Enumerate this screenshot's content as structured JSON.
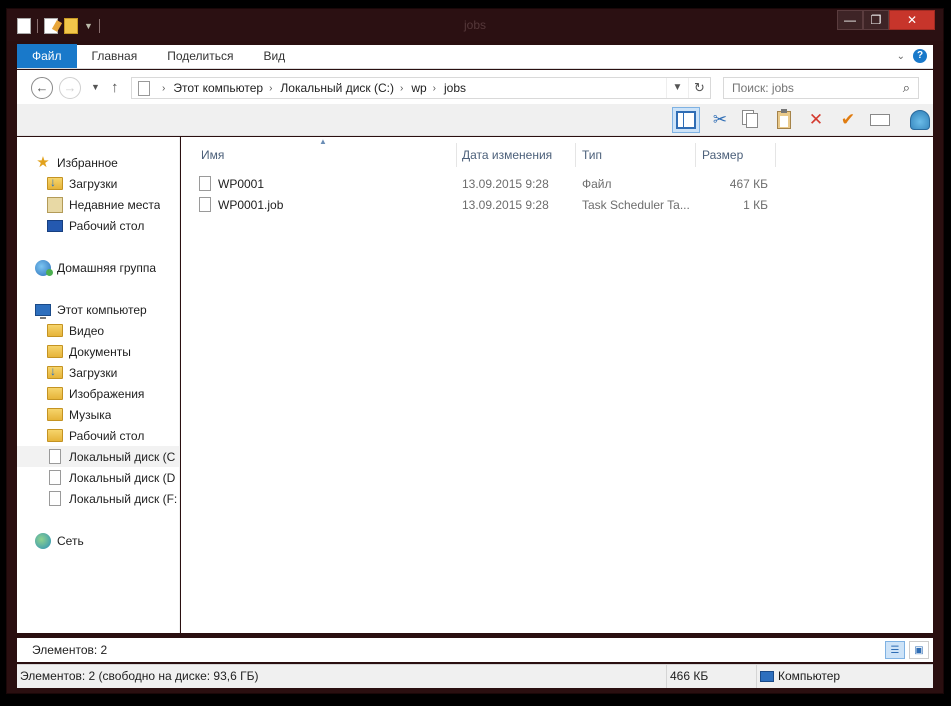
{
  "window": {
    "title": "jobs"
  },
  "ribbon": {
    "tabs": [
      "Файл",
      "Главная",
      "Поделиться",
      "Вид"
    ],
    "help": "?"
  },
  "address": {
    "breadcrumbs": [
      "Этот компьютер",
      "Локальный диск (C:)",
      "wp",
      "jobs"
    ]
  },
  "search": {
    "placeholder": "Поиск: jobs"
  },
  "nav": {
    "favorites": "Избранное",
    "fav_items": [
      "Загрузки",
      "Недавние места",
      "Рабочий стол"
    ],
    "homegroup": "Домашняя группа",
    "computer": "Этот компьютер",
    "pc_items": [
      "Видео",
      "Документы",
      "Загрузки",
      "Изображения",
      "Музыка",
      "Рабочий стол",
      "Локальный диск (C",
      "Локальный диск (D",
      "Локальный диск (F:"
    ],
    "network": "Сеть"
  },
  "columns": {
    "name": "Имя",
    "date": "Дата изменения",
    "type": "Тип",
    "size": "Размер"
  },
  "files": [
    {
      "name": "WP0001",
      "date": "13.09.2015 9:28",
      "type": "Файл",
      "size": "467 КБ"
    },
    {
      "name": "WP0001.job",
      "date": "13.09.2015 9:28",
      "type": "Task Scheduler Ta...",
      "size": "1 КБ"
    }
  ],
  "status": {
    "items_count": "Элементов: 2",
    "detail": "Элементов: 2 (свободно на диске: 93,6 ГБ)",
    "size": "466 КБ",
    "location": "Компьютер"
  },
  "icons": [
    "new-file-icon",
    "properties-icon",
    "folder-icon",
    "back-icon",
    "forward-icon",
    "up-icon",
    "refresh-icon",
    "search-icon",
    "preview-pane-icon",
    "cut-icon",
    "copy-icon",
    "paste-icon",
    "delete-icon",
    "check-icon",
    "rename-icon",
    "shell-icon",
    "star-icon",
    "downloads-icon",
    "recent-places-icon",
    "desktop-icon",
    "homegroup-icon",
    "computer-icon",
    "drive-icon",
    "network-icon"
  ]
}
